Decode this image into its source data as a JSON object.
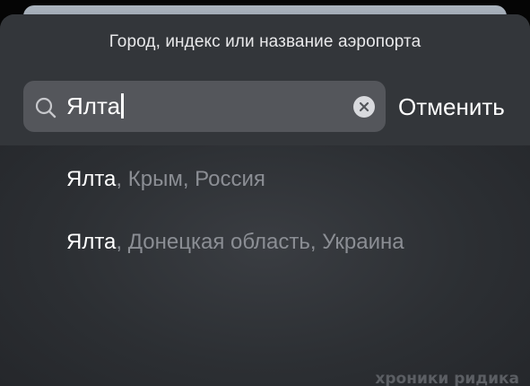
{
  "search_sheet": {
    "prompt": "Город, индекс или название аэропорта",
    "search": {
      "value": "Ялта",
      "icon": "search-icon",
      "clear_icon": "clear-icon"
    },
    "cancel_label": "Отменить"
  },
  "results": [
    {
      "city": "Ялта",
      "region": ", Крым, Россия"
    },
    {
      "city": "Ялта",
      "region": ", Донецкая область, Украина"
    }
  ],
  "watermark": "хроники ридика",
  "colors": {
    "sheet_background": "#2e3034",
    "search_field": "#54565b",
    "primary_text": "#ffffff",
    "secondary_text": "#8b8e94"
  }
}
